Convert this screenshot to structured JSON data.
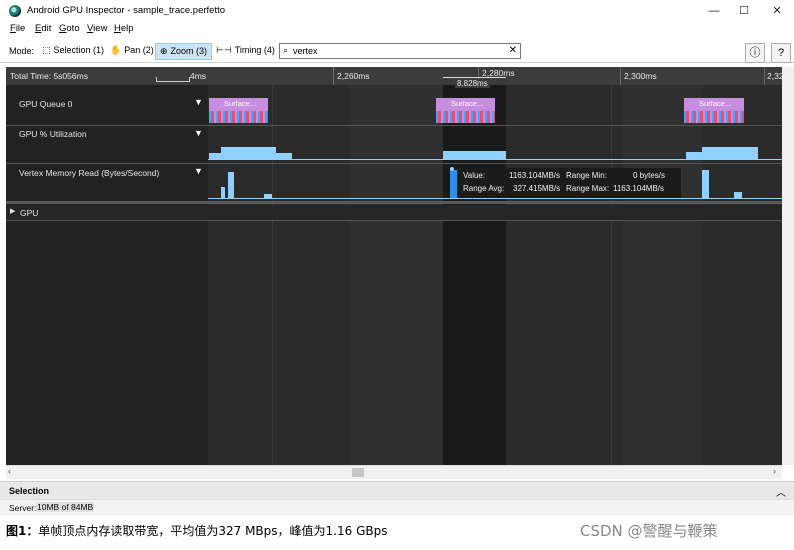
{
  "window": {
    "title": "Android GPU Inspector - sample_trace.perfetto",
    "minimize": "—",
    "maximize": "☐",
    "close": "✕"
  },
  "menu": [
    {
      "label": "File",
      "key": "F",
      "rest": "ile"
    },
    {
      "label": "Edit",
      "key": "E",
      "rest": "dit"
    },
    {
      "label": "Goto",
      "key": "G",
      "rest": "oto"
    },
    {
      "label": "View",
      "key": "V",
      "rest": "iew"
    },
    {
      "label": "Help",
      "key": "H",
      "rest": "elp"
    }
  ],
  "modebar": {
    "label": "Mode:",
    "modes": [
      {
        "label": "Selection (1)",
        "icon": "cursor-icon",
        "active": false
      },
      {
        "label": "Pan (2)",
        "icon": "hand-icon",
        "active": false
      },
      {
        "label": "Zoom (3)",
        "icon": "zoom-icon",
        "active": true
      },
      {
        "label": "Timing (4)",
        "icon": "timing-icon",
        "active": false
      }
    ],
    "search_value": "vertex",
    "info_icon": "ⓘ",
    "help_icon": "?"
  },
  "timeline": {
    "total_time": "Total Time: 5s056ms",
    "scale_label": "4ms",
    "ticks": [
      "2,260ms",
      "2,280ms",
      "2,300ms",
      "2,32"
    ],
    "selection_duration": "8.828ms",
    "tracks": [
      {
        "name": "GPU Queue 0"
      },
      {
        "name": "GPU % Utilization"
      },
      {
        "name": "Vertex Memory Read (Bytes/Second)"
      }
    ],
    "slice_label": "Surface...",
    "group": "GPU"
  },
  "tooltip": {
    "value_label": "Value:",
    "value": "1163.104MB/s",
    "range_min_label": "Range Min:",
    "range_min": "0 bytes/s",
    "range_avg_label": "Range Avg:",
    "range_avg": "327.415MB/s",
    "range_max_label": "Range Max:",
    "range_max": "1163.104MB/s"
  },
  "selection_panel": {
    "title": "Selection"
  },
  "status": {
    "server_label": "Server:",
    "server_value": "10MB of 84MB"
  },
  "caption": {
    "prefix": "图1：",
    "text": "单帧顶点内存读取带宽，平均值为327 MBps，峰值为1.16 GBps"
  },
  "watermark": "CSDN @警醒与鞭策",
  "colors": {
    "slice": "#c78ee0",
    "bar": "#8fd0ff",
    "track_bg": "#2b2b2b",
    "selection_bg": "#1a1a1a"
  }
}
